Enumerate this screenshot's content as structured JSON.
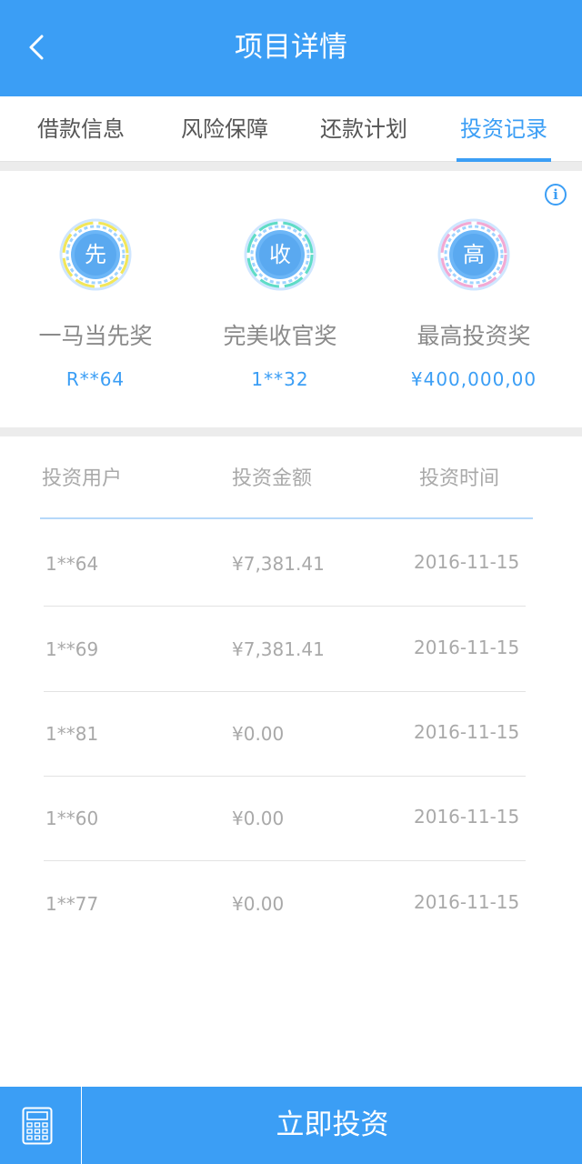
{
  "header": {
    "title": "项目详情",
    "back_icon": "chevron-left-icon"
  },
  "tabs": [
    {
      "label": "借款信息",
      "active": false
    },
    {
      "label": "风险保障",
      "active": false
    },
    {
      "label": "还款计划",
      "active": false
    },
    {
      "label": "投资记录",
      "active": true
    }
  ],
  "awards": [
    {
      "badge_text": "先",
      "name": "一马当先奖",
      "user": "R**64",
      "badge_color": "#f2e65a"
    },
    {
      "badge_text": "收",
      "name": "完美收官奖",
      "user": "1**32",
      "badge_color": "#5fdcc6"
    },
    {
      "badge_text": "高",
      "name": "最高投资奖",
      "user": "¥400,000,00",
      "badge_color": "#f2a9d4"
    }
  ],
  "info_icon": "info-icon",
  "table": {
    "headers": [
      "投资用户",
      "投资金额",
      "投资时间"
    ],
    "rows": [
      {
        "user": "1**64",
        "amount": "¥7,381.41",
        "time": "2016-11-15"
      },
      {
        "user": "1**69",
        "amount": "¥7,381.41",
        "time": "2016-11-15"
      },
      {
        "user": "1**81",
        "amount": "¥0.00",
        "time": "2016-11-15"
      },
      {
        "user": "1**60",
        "amount": "¥0.00",
        "time": "2016-11-15"
      },
      {
        "user": "1**77",
        "amount": "¥0.00",
        "time": "2016-11-15"
      }
    ]
  },
  "footer": {
    "calculator_icon": "calculator-icon",
    "invest_label": "立即投资"
  },
  "colors": {
    "primary": "#3b9ef5",
    "text_gray": "#a9a9a9",
    "divider": "#e2e2e2"
  }
}
